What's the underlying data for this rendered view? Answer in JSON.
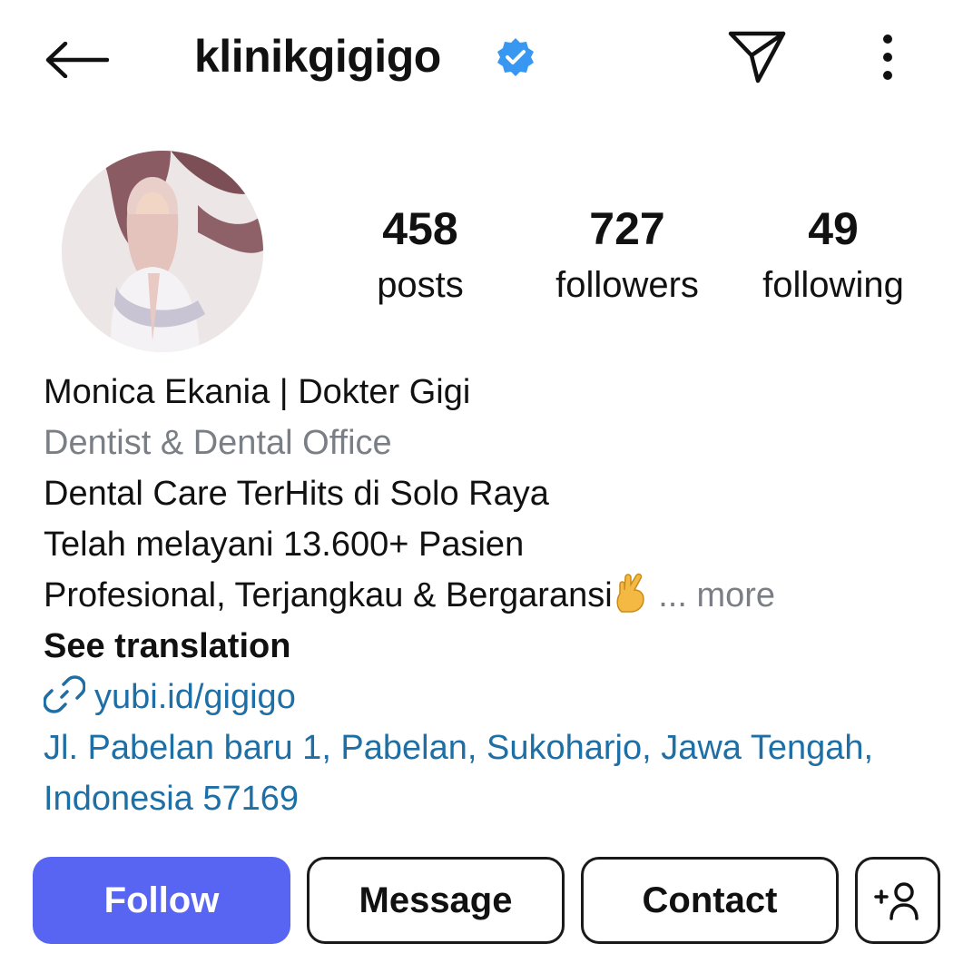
{
  "header": {
    "username": "klinikgigigo",
    "back_icon": "arrow-left-icon",
    "verified_icon": "verified-badge-icon",
    "send_icon": "paper-plane-icon",
    "more_icon": "vertical-dots-icon",
    "verified_color": "#3897f0"
  },
  "profile": {
    "avatar_icon": "profile-avatar"
  },
  "stats": [
    {
      "value": "458",
      "label": "posts"
    },
    {
      "value": "727",
      "label": "followers"
    },
    {
      "value": "49",
      "label": "following"
    }
  ],
  "bio": {
    "name": "Monica Ekania | Dokter Gigi",
    "category": "Dentist & Dental Office",
    "lines": [
      "Dental Care TerHits di Solo Raya",
      "Telah melayani 13.600+ Pasien",
      "Profesional, Terjangkau & Bergaransi"
    ],
    "emoji_icon": "crossed-fingers-emoji-icon",
    "more_label": "... more",
    "see_translation": "See translation",
    "link_icon": "link-icon",
    "link": "yubi.id/gigigo",
    "address": "Jl. Pabelan baru 1, Pabelan, Sukoharjo, Jawa Tengah, Indonesia 57169"
  },
  "actions": {
    "follow": "Follow",
    "message": "Message",
    "contact": "Contact",
    "add_user_icon": "add-person-icon"
  },
  "colors": {
    "follow_button": "#5765f2",
    "link": "#1d6fa6",
    "secondary_text": "#7a7f85"
  }
}
